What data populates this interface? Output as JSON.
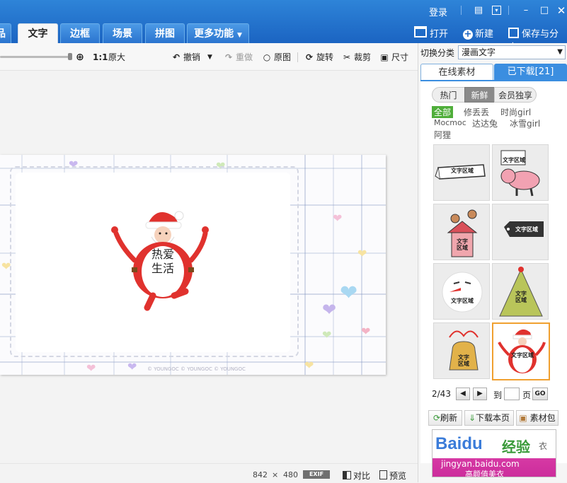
{
  "window": {
    "login_label": "登录",
    "open_label": "打开",
    "new_label": "新建",
    "save_share_label": "保存与分享"
  },
  "tabs": [
    {
      "label": "品"
    },
    {
      "label": "文字"
    },
    {
      "label": "边框"
    },
    {
      "label": "场景"
    },
    {
      "label": "拼图"
    },
    {
      "label": "更多功能"
    }
  ],
  "toolbar": {
    "zoom_ratio": "1:1",
    "original_size": "原大",
    "undo": "撤销",
    "redo": "重做",
    "original": "原图",
    "rotate": "旋转",
    "crop": "裁剪",
    "size": "尺寸"
  },
  "canvas": {
    "sticker_text_line1": "热爱",
    "sticker_text_line2": "生活",
    "watermark": "© YOUNGOC  © YOUNGOC  © YOUNGOC"
  },
  "status": {
    "width": "842",
    "times": "×",
    "height": "480",
    "exif_label": "EXIF",
    "compare_label": "对比",
    "preview_label": "预览"
  },
  "panel": {
    "switch_label": "切换分类",
    "switch_value": "漫画文字",
    "tab_online": "在线素材",
    "tab_downloaded": "已下载[21]",
    "segments": [
      "热门",
      "新鲜",
      "会员独享"
    ],
    "categories": [
      "全部",
      "修丢丢",
      "时尚girl",
      "Mocmoc",
      "达达兔",
      "冰雪girl",
      "阿狸"
    ],
    "thumb_label": "文字区域",
    "page_indicator": "2/43",
    "goto_label": "到",
    "page_label": "页",
    "go_label": "GO",
    "refresh_label": "刷新",
    "download_page_label": "下载本页",
    "pack_label": "素材包"
  },
  "ad": {
    "brand": "Baidu",
    "brand_suffix": "经验",
    "url": "jingyan.baidu.com",
    "tag": "高颜值美衣",
    "corner": "衣"
  },
  "colors": {
    "topbar": "#1b64c2",
    "panel_tab": "#3b8ee0",
    "selected_category": "#4fae3a",
    "selected_thumb": "#f0a030",
    "santa_red": "#e0322e"
  }
}
